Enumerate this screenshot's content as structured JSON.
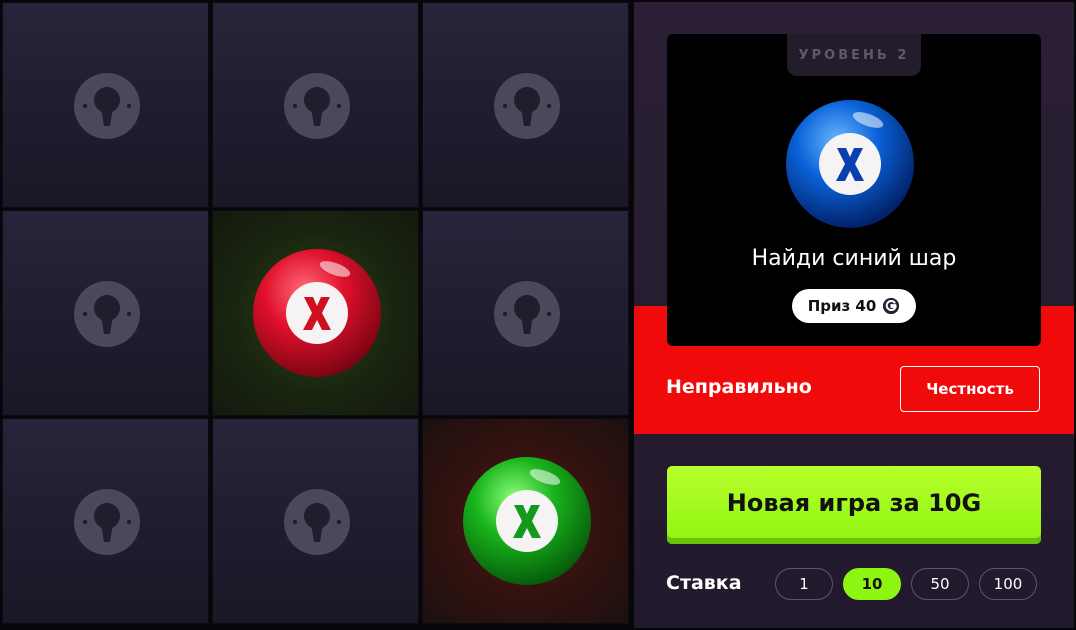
{
  "grid": {
    "cells": [
      {
        "state": "locked"
      },
      {
        "state": "locked"
      },
      {
        "state": "locked"
      },
      {
        "state": "locked"
      },
      {
        "state": "revealed",
        "ball": "red",
        "glow": "green"
      },
      {
        "state": "locked"
      },
      {
        "state": "locked"
      },
      {
        "state": "locked"
      },
      {
        "state": "revealed",
        "ball": "green",
        "glow": "red"
      }
    ]
  },
  "card": {
    "level_label": "УРОВЕНЬ 2",
    "target_ball": "blue",
    "task_text": "Найди синий шар",
    "prize_label": "Приз 40",
    "prize_icon": "g-coin-icon"
  },
  "result": {
    "status_text": "Неправильно",
    "fairness_label": "Честность",
    "color": "#f10a0a"
  },
  "actions": {
    "new_game_label": "Новая игра за 10G"
  },
  "stake": {
    "label": "Ставка",
    "options": [
      "1",
      "10",
      "50",
      "100"
    ],
    "selected": "10"
  },
  "colors": {
    "accent_green": "#8ef512",
    "error_red": "#f10a0a",
    "ball_red": "#e0102c",
    "ball_green": "#18b31c",
    "ball_blue": "#0a62d8"
  }
}
